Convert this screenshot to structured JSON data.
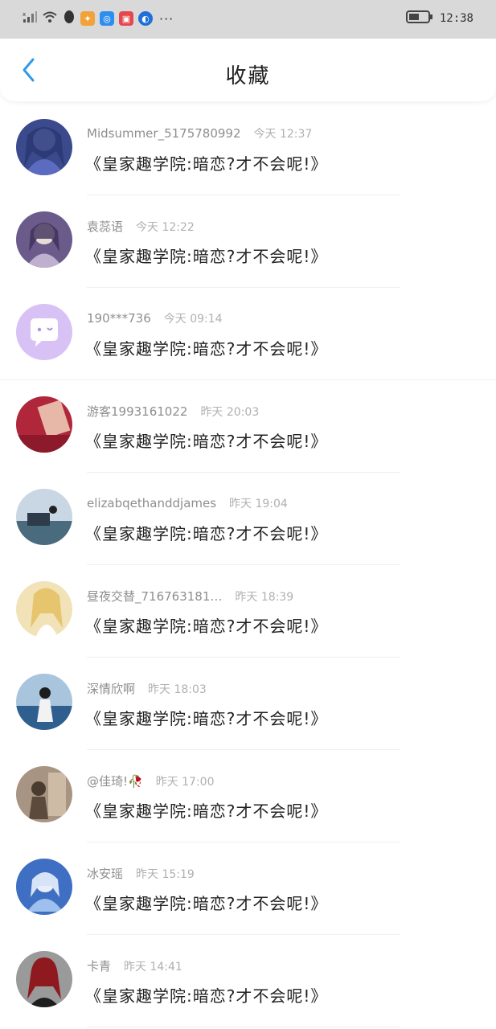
{
  "status_bar": {
    "time": "12:38",
    "left_icons": [
      "signal-icon",
      "wifi-icon",
      "qq-penguin-icon",
      "color-app-icon",
      "search-app-icon",
      "red-app-icon",
      "bulb-app-icon",
      "more-dots-icon"
    ],
    "right_icons": [
      "battery-icon"
    ],
    "colors": {
      "bg": "#d9d9d9"
    }
  },
  "header": {
    "back_icon": "chevron-left-icon",
    "title": "收藏",
    "colors": {
      "back": "#2f9bea"
    }
  },
  "items": [
    {
      "user": "Midsummer_5175780992",
      "time": "今天 12:37",
      "message": "《皇家趣学院:暗恋?才不会呢!》",
      "avatar": "blue-anime-girl",
      "avatar_color": "#3b4a8c"
    },
    {
      "user": "袁蕊语",
      "time": "今天 12:22",
      "message": "《皇家趣学院:暗恋?才不会呢!》",
      "avatar": "purple-anime-girl",
      "avatar_color": "#6b5b8a"
    },
    {
      "user": "190***736",
      "time": "今天 09:14",
      "message": "《皇家趣学院:暗恋?才不会呢!》",
      "avatar": "default-chat-avatar",
      "avatar_color": "#d8c2f5"
    },
    {
      "user": "游客1993161022",
      "time": "昨天 20:03",
      "message": "《皇家趣学院:暗恋?才不会呢!》",
      "avatar": "red-envelope-photo",
      "avatar_color": "#b0263a"
    },
    {
      "user": "elizabqethanddjames",
      "time": "昨天 19:04",
      "message": "《皇家趣学院:暗恋?才不会呢!》",
      "avatar": "seaside-chair-photo",
      "avatar_color": "#6c8aa8"
    },
    {
      "user": "昼夜交替_716763181…",
      "time": "昨天 18:39",
      "message": "《皇家趣学院:暗恋?才不会呢!》",
      "avatar": "golden-anime-girl",
      "avatar_color": "#e9cf8a"
    },
    {
      "user": "深情欣啊",
      "time": "昨天 18:03",
      "message": "《皇家趣学院:暗恋?才不会呢!》",
      "avatar": "beach-girl-photo",
      "avatar_color": "#3a6ea0"
    },
    {
      "user": "@佳琦!🥀",
      "time": "昨天 17:00",
      "message": "《皇家趣学院:暗恋?才不会呢!》",
      "avatar": "sepia-girl-photo",
      "avatar_color": "#8b7360"
    },
    {
      "user": "冰安瑶",
      "time": "昨天 15:19",
      "message": "《皇家趣学院:暗恋?才不会呢!》",
      "avatar": "blue-anime-art",
      "avatar_color": "#3f6fc2"
    },
    {
      "user": "卡青",
      "time": "昨天 14:41",
      "message": "《皇家趣学院:暗恋?才不会呢!》",
      "avatar": "red-hair-anime",
      "avatar_color": "#7a1e22"
    }
  ]
}
